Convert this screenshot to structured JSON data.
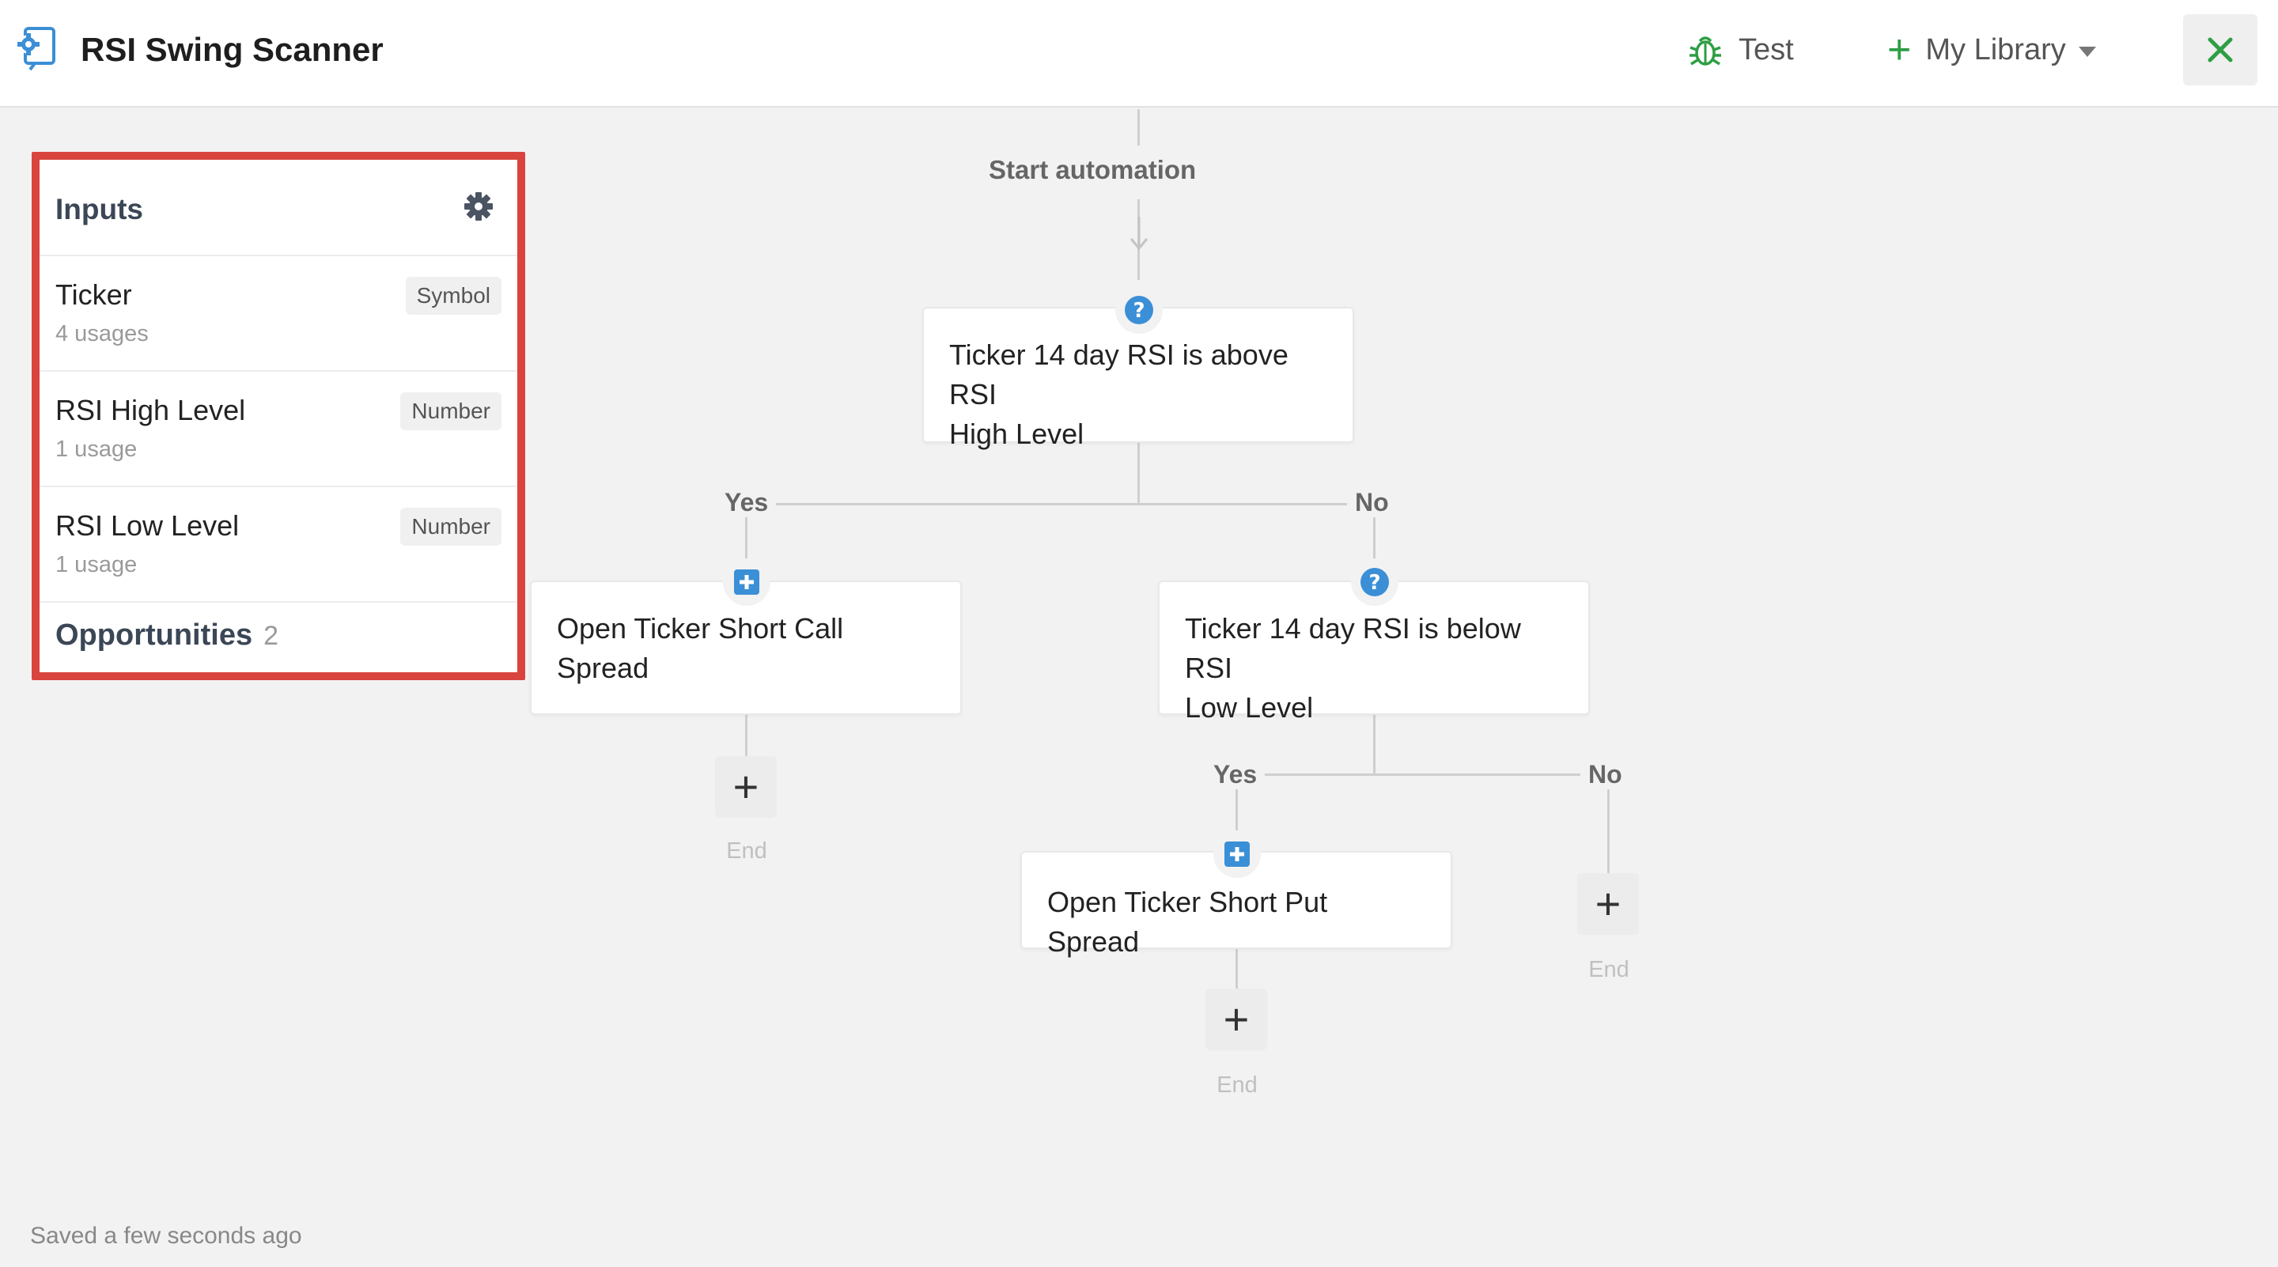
{
  "header": {
    "title": "RSI Swing Scanner",
    "app_icon": "automation-gear-icon",
    "test_label": "Test",
    "library_label": "My Library",
    "accent_color": "#2e9e44"
  },
  "inputs": {
    "title": "Inputs",
    "items": [
      {
        "name": "Ticker",
        "usage": "4 usages",
        "type": "Symbol"
      },
      {
        "name": "RSI High Level",
        "usage": "1 usage",
        "type": "Number"
      },
      {
        "name": "RSI Low Level",
        "usage": "1 usage",
        "type": "Number"
      }
    ],
    "opportunities_label": "Opportunities",
    "opportunities_count": "2",
    "highlight_color": "#d9443e"
  },
  "flow": {
    "start_label": "Start automation",
    "condition1": {
      "line1": "Ticker 14 day RSI is above RSI",
      "line2": "High Level"
    },
    "yes1": "Yes",
    "no1": "No",
    "action1": {
      "line1": "Open Ticker Short Call",
      "line2": "Spread"
    },
    "condition2": {
      "line1": "Ticker 14 day RSI is below RSI",
      "line2": "Low Level"
    },
    "yes2": "Yes",
    "no2": "No",
    "action2": "Open Ticker Short Put Spread",
    "end_label": "End",
    "condition_icon_color": "#3b8fd6",
    "action_icon_color": "#3b8fd6"
  },
  "footer": {
    "status": "Saved a few seconds ago"
  }
}
